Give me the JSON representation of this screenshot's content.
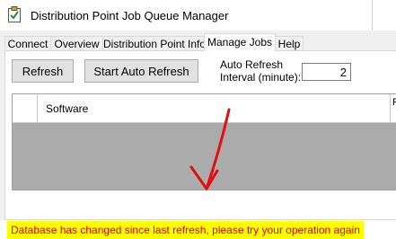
{
  "window": {
    "title": "Distribution Point Job Queue Manager",
    "app_icon": "clipboard-check-icon"
  },
  "tabs": [
    {
      "label": "Connect",
      "active": false
    },
    {
      "label": "Overview",
      "active": false
    },
    {
      "label": "Distribution Point Info",
      "active": false
    },
    {
      "label": "Manage Jobs",
      "active": true
    },
    {
      "label": "Help",
      "active": false
    }
  ],
  "manage_jobs": {
    "refresh_label": "Refresh",
    "auto_refresh_label": "Start Auto Refresh",
    "interval_label": "Auto Refresh Interval (minute):",
    "interval_value": "2"
  },
  "grid": {
    "columns": [
      "Software",
      "P"
    ]
  },
  "status": {
    "message": "Database has changed since last refresh, please try your operation again",
    "background": "#ffff00",
    "color": "#e00000"
  },
  "annotation": {
    "arrow_color": "#e01010",
    "icon": "red-arrow-annotation"
  }
}
